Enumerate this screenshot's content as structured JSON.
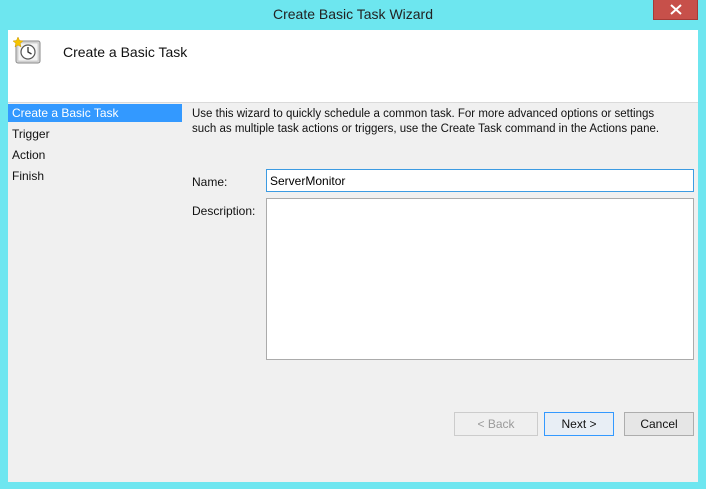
{
  "window": {
    "title": "Create Basic Task Wizard"
  },
  "header": {
    "title": "Create a Basic Task",
    "icon": "task-scheduler-clock-icon"
  },
  "nav": {
    "items": [
      {
        "label": "Create a Basic Task",
        "active": true
      },
      {
        "label": "Trigger",
        "active": false
      },
      {
        "label": "Action",
        "active": false
      },
      {
        "label": "Finish",
        "active": false
      }
    ]
  },
  "form": {
    "intro_line1": "Use this wizard to quickly schedule a common task.  For more advanced options or settings",
    "intro_line2": "such as multiple task actions or triggers, use the Create Task command in the Actions pane.",
    "name_label": "Name:",
    "name_value": "ServerMonitor",
    "description_label": "Description:",
    "description_value": ""
  },
  "buttons": {
    "back_label": "< Back",
    "next_label": "Next >",
    "cancel_label": "Cancel"
  },
  "colors": {
    "title_bar": "#6de6ef",
    "close_button": "#c7504a",
    "selection": "#3399ff",
    "focus_border": "#3c9be2"
  }
}
